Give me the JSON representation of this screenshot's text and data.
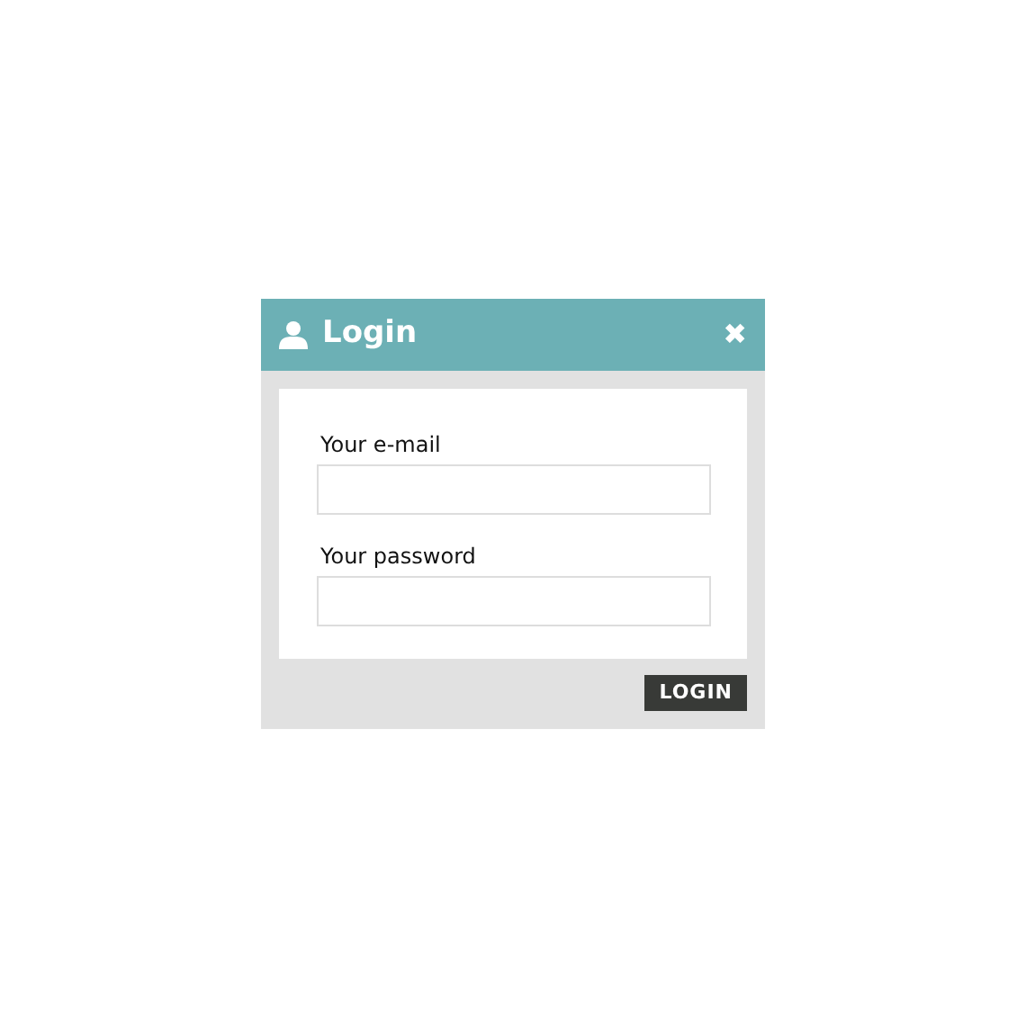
{
  "dialog": {
    "title": "Login",
    "close": "✖"
  },
  "fields": [
    {
      "label": "Your e-mail"
    },
    {
      "label": "Your password"
    }
  ],
  "submit": "LOGIN"
}
